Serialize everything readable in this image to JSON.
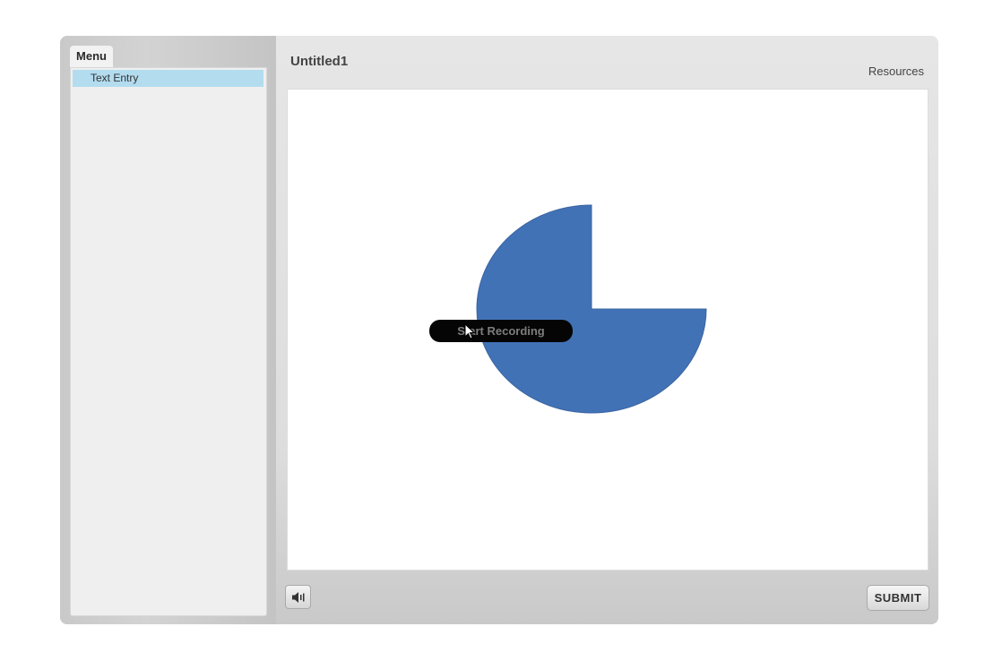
{
  "sidebar": {
    "menu_tab_label": "Menu",
    "items": [
      {
        "label": "Text Entry",
        "selected": true
      }
    ]
  },
  "main": {
    "slide_title": "Untitled1",
    "resources_label": "Resources"
  },
  "stage": {
    "shape_color": "#4272b6",
    "pie_missing_fraction": 0.25,
    "record_button_label": "Start Recording"
  },
  "bottom_bar": {
    "audio_icon": "speaker-icon",
    "submit_label": "SUBMIT"
  },
  "colors": {
    "menu_item_selected_bg": "#b3dcef",
    "record_button_bg": "#050505"
  }
}
